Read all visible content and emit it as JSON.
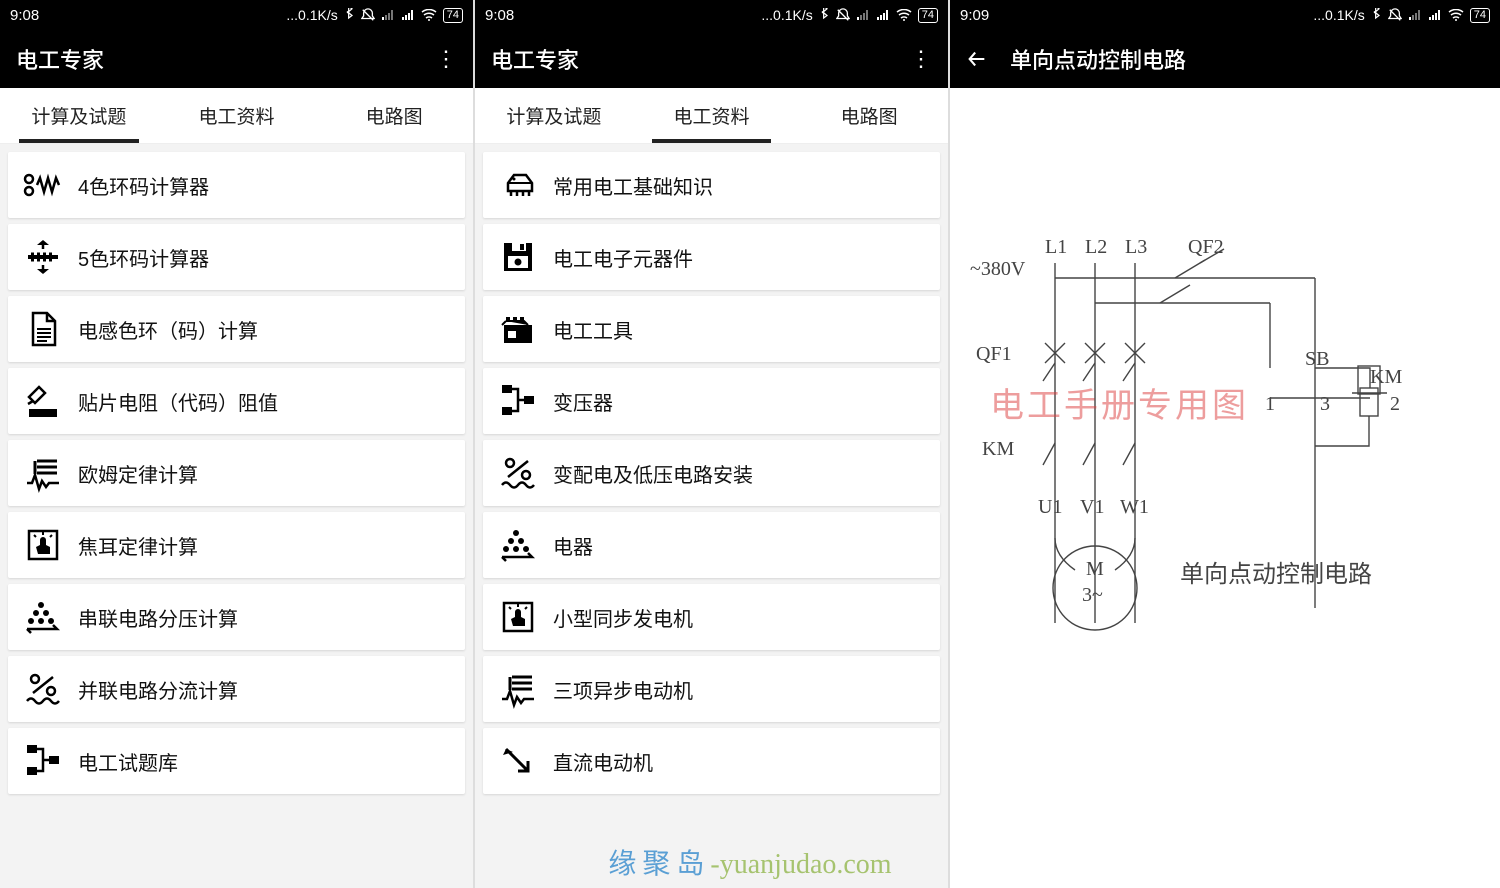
{
  "status": {
    "time_a": "9:08",
    "time_b": "9:08",
    "time_c": "9:09",
    "net": "...0.1K/s",
    "battery": "74"
  },
  "header": {
    "app_title": "电工专家",
    "s3_title": "单向点动控制电路"
  },
  "tabs": {
    "t1": "计算及试题",
    "t2": "电工资料",
    "t3": "电路图"
  },
  "screen1_items": [
    {
      "label": "4色环码计算器",
      "icon": "resistor-4"
    },
    {
      "label": "5色环码计算器",
      "icon": "bands-5"
    },
    {
      "label": "电感色环（码）计算",
      "icon": "doc"
    },
    {
      "label": "贴片电阻（代码）阻值",
      "icon": "smd"
    },
    {
      "label": "欧姆定律计算",
      "icon": "pulse-lines"
    },
    {
      "label": "焦耳定律计算",
      "icon": "touch"
    },
    {
      "label": "串联电路分压计算",
      "icon": "pyramid"
    },
    {
      "label": "并联电路分流计算",
      "icon": "percent-wave"
    },
    {
      "label": "电工试题库",
      "icon": "sitemap"
    }
  ],
  "screen2_items": [
    {
      "label": "常用电工基础知识",
      "icon": "chip"
    },
    {
      "label": "电工电子元器件",
      "icon": "floppy"
    },
    {
      "label": "电工工具",
      "icon": "toolbox"
    },
    {
      "label": "变压器",
      "icon": "sitemap"
    },
    {
      "label": "变配电及低压电路安装",
      "icon": "percent-wave"
    },
    {
      "label": "电器",
      "icon": "pyramid"
    },
    {
      "label": "小型同步发电机",
      "icon": "touch"
    },
    {
      "label": "三项异步电动机",
      "icon": "pulse-lines"
    },
    {
      "label": "直流电动机",
      "icon": "arrow-diag"
    }
  ],
  "diagram": {
    "voltage": "~380V",
    "L1": "L1",
    "L2": "L2",
    "L3": "L3",
    "QF1": "QF1",
    "QF2": "QF2",
    "KM": "KM",
    "KM2": "KM",
    "SB": "SB",
    "U1": "U1",
    "V1": "V1",
    "W1": "W1",
    "n1": "1",
    "n2": "2",
    "n3": "3",
    "M": "M",
    "M3": "3~",
    "caption": "单向点动控制电路",
    "watermark_mid": "电工手册专用图"
  },
  "footer": {
    "cn": "缘聚岛",
    "en": "-yuanjudao.com"
  }
}
